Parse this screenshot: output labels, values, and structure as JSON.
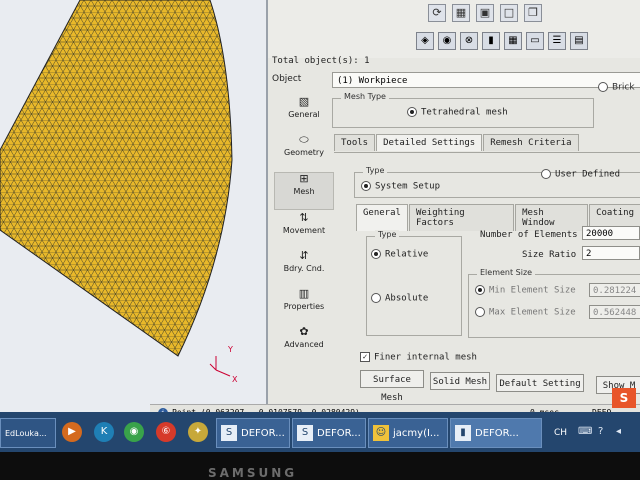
{
  "toolbar": {
    "total_objects": "Total object(s): 1"
  },
  "object": {
    "label": "Object",
    "value": "(1) Workpiece",
    "brick_label": "Brick"
  },
  "sidebar": {
    "items": [
      {
        "label": "General",
        "icon": "general-icon"
      },
      {
        "label": "Geometry",
        "icon": "geometry-icon"
      },
      {
        "label": "Mesh",
        "icon": "mesh-icon"
      },
      {
        "label": "Movement",
        "icon": "movement-icon"
      },
      {
        "label": "Bdry. Cnd.",
        "icon": "boundary-condition-icon"
      },
      {
        "label": "Properties",
        "icon": "properties-icon"
      },
      {
        "label": "Advanced",
        "icon": "advanced-icon"
      }
    ]
  },
  "mesh_type": {
    "title": "Mesh Type",
    "option": "Tetrahedral mesh"
  },
  "main_tabs": [
    "Tools",
    "Detailed Settings",
    "Remesh Criteria"
  ],
  "type_group": {
    "title": "Type",
    "system_setup": "System Setup",
    "user_defined": "User Defined"
  },
  "sub_tabs": [
    "General",
    "Weighting Factors",
    "Mesh Window",
    "Coating"
  ],
  "relative_group": {
    "title": "Type",
    "relative": "Relative",
    "absolute": "Absolute"
  },
  "elements": {
    "number_label": "Number of Elements",
    "number_value": "20000",
    "size_ratio_label": "Size Ratio",
    "size_ratio_value": "2"
  },
  "element_size": {
    "title": "Element Size",
    "min_label": "Min Element Size",
    "min_value": "0.281224",
    "max_label": "Max Element Size",
    "max_value": "0.562448"
  },
  "finer_mesh": "Finer internal mesh",
  "buttons": {
    "surface_mesh": "Surface Mesh",
    "solid_mesh": "Solid Mesh",
    "default_setting": "Default Setting",
    "show_mesh": "Show M"
  },
  "status": {
    "point": "Point (0.063207, -0.0107579, 0.0280429)",
    "time": "0 msec",
    "deform_short": "DEFO"
  },
  "taskbar": {
    "items": [
      {
        "label": "DEFOR...",
        "icon": "deform-icon"
      },
      {
        "label": "DEFOR...",
        "icon": "deform-icon"
      },
      {
        "label": "jacmy(I...",
        "icon": "chat-icon"
      },
      {
        "label": "DEFOR...",
        "icon": "database-icon"
      }
    ],
    "lang": "CH",
    "partial_app": "EdLoukа..."
  },
  "axis": {
    "x": "X",
    "y": "Y"
  },
  "monitor_brand": "SAMSUNG",
  "colors": {
    "mesh_fill": "#e8b82a",
    "panel_bg": "#e7e7e2",
    "taskbar": "#24466e"
  }
}
